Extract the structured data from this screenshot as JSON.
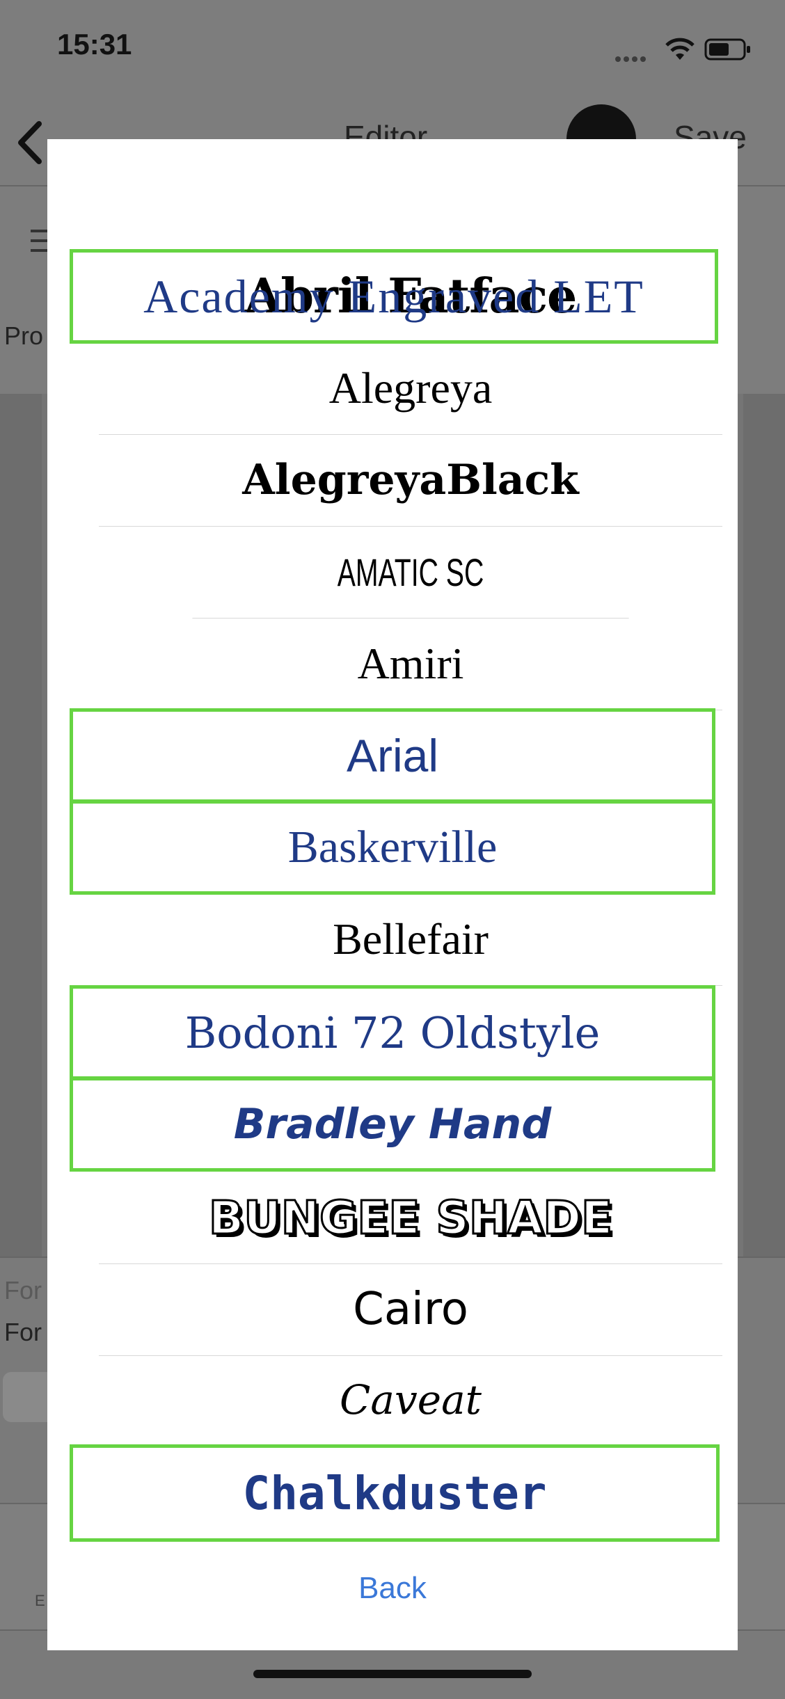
{
  "status_bar": {
    "time": "15:31"
  },
  "nav": {
    "title": "Editor",
    "save_label": "Save"
  },
  "background_labels": {
    "pro": "Pro",
    "for_1": "For",
    "for_2": "For",
    "bottom_letter": "E"
  },
  "font_picker": {
    "fonts": [
      {
        "name": "Abril Fatface",
        "highlighted": false
      },
      {
        "name": "Academy Engraved LET",
        "highlighted": true
      },
      {
        "name": "Alegreya",
        "highlighted": false
      },
      {
        "name": "AlegreyaBlack",
        "highlighted": false
      },
      {
        "name": "Amatic SC",
        "highlighted": false
      },
      {
        "name": "Amiri",
        "highlighted": false
      },
      {
        "name": "Arial",
        "highlighted": true
      },
      {
        "name": "Baskerville",
        "highlighted": true
      },
      {
        "name": "Bellefair",
        "highlighted": false
      },
      {
        "name": "Bodoni 72 Oldstyle",
        "highlighted": true
      },
      {
        "name": "Bradley Hand",
        "highlighted": true
      },
      {
        "name": "BUNGEE SHADE",
        "highlighted": false
      },
      {
        "name": "Cairo",
        "highlighted": false
      },
      {
        "name": "Caveat",
        "highlighted": false
      },
      {
        "name": "Chalkduster",
        "highlighted": true
      }
    ],
    "back_label": "Back",
    "highlight_color": "#66d442",
    "highlight_text_color": "#1f3a86"
  }
}
